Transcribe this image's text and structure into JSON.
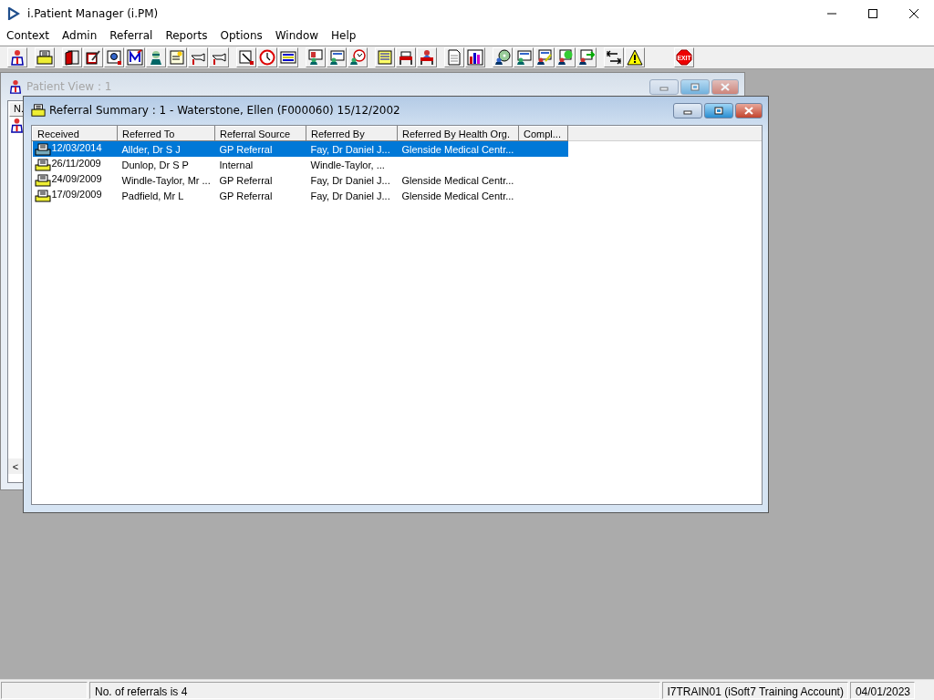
{
  "app": {
    "title": "i.Patient Manager (i.PM)"
  },
  "menu": [
    "Context",
    "Admin",
    "Referral",
    "Reports",
    "Options",
    "Window",
    "Help"
  ],
  "toolbar": {
    "exit_label": "EXIT"
  },
  "patient_view": {
    "title": "Patient View : 1",
    "active": false,
    "column_1": "N.",
    "scroll_left": "<"
  },
  "referral_summary": {
    "title": "Referral Summary : 1 - Waterstone, Ellen (F000060) 15/12/2002",
    "active": true,
    "columns": [
      "Received",
      "Referred To",
      "Referral Source",
      "Referred By",
      "Referred By Health Org.",
      "Compl..."
    ],
    "rows": [
      {
        "selected": true,
        "cells": [
          "12/03/2014",
          "Allder, Dr S J",
          "GP Referral",
          "Fay, Dr Daniel J...",
          "Glenside Medical Centr..."
        ]
      },
      {
        "selected": false,
        "cells": [
          "26/11/2009",
          "Dunlop, Dr S P",
          "Internal",
          "Windle-Taylor, ...",
          ""
        ]
      },
      {
        "selected": false,
        "cells": [
          "24/09/2009",
          "Windle-Taylor, Mr ...",
          "GP Referral",
          "Fay, Dr Daniel J...",
          "Glenside Medical Centr..."
        ]
      },
      {
        "selected": false,
        "cells": [
          "17/09/2009",
          "Padfield, Mr L",
          "GP Referral",
          "Fay, Dr Daniel J...",
          "Glenside Medical Centr..."
        ]
      }
    ]
  },
  "status_bar": [
    "No. of referrals is 4",
    "I7TRAIN01 (iSoft7 Training Account)",
    "04/01/2023"
  ]
}
